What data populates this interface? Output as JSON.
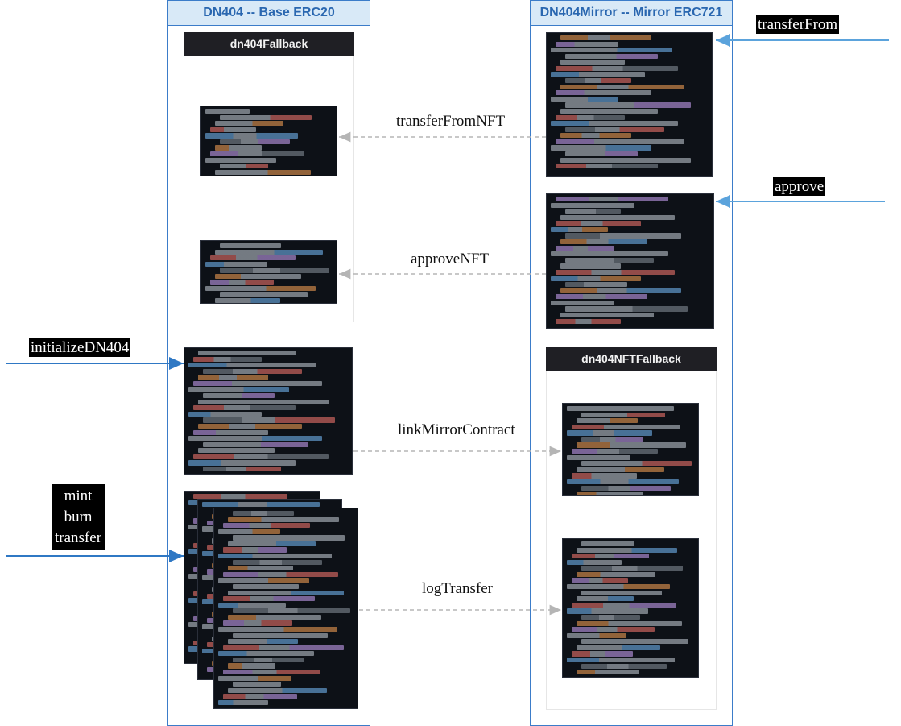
{
  "columns": {
    "left_title": "DN404 -- Base ERC20",
    "right_title": "DN404Mirror -- Mirror ERC721"
  },
  "subpanels": {
    "left_fallback_title": "dn404Fallback",
    "right_fallback_title": "dn404NFTFallback"
  },
  "labels": {
    "transferFrom": "transferFrom",
    "approve": "approve",
    "initializeDN404": "initializeDN404",
    "mint_burn_transfer": [
      "mint",
      "burn",
      "transfer"
    ],
    "transferFromNFT": "transferFromNFT",
    "approveNFT": "approveNFT",
    "linkMirrorContract": "linkMirrorContract",
    "logTransfer": "logTransfer"
  },
  "colors": {
    "column_border": "#3b7cc9",
    "column_header_bg": "#d8e9f7",
    "arrow_external_right": "#5ba3dc",
    "arrow_external_left": "#2f78c4",
    "arrow_internal": "#b5b5b5",
    "code_bg": "#0d1117"
  }
}
